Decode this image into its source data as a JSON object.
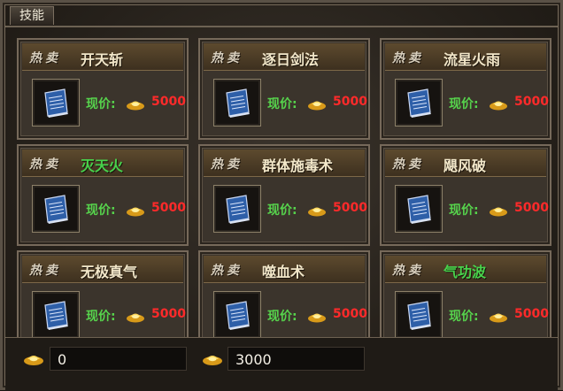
{
  "window": {
    "tab_title": "技能"
  },
  "shop": {
    "hot_label": "热卖",
    "price_label": "现价:",
    "items": [
      {
        "name": "开天斩",
        "price": "5000",
        "name_color": "#f2e7c9"
      },
      {
        "name": "逐日剑法",
        "price": "5000",
        "name_color": "#f2e7c9"
      },
      {
        "name": "流星火雨",
        "price": "5000",
        "name_color": "#f2e7c9"
      },
      {
        "name": "灭天火",
        "price": "5000",
        "name_color": "#48d24c"
      },
      {
        "name": "群体施毒术",
        "price": "5000",
        "name_color": "#f2e7c9"
      },
      {
        "name": "飓风破",
        "price": "5000",
        "name_color": "#f2e7c9"
      },
      {
        "name": "无极真气",
        "price": "5000",
        "name_color": "#f2e7c9"
      },
      {
        "name": "噬血术",
        "price": "5000",
        "name_color": "#f2e7c9"
      },
      {
        "name": "气功波",
        "price": "5000",
        "name_color": "#48d24c"
      }
    ]
  },
  "currency": {
    "left_value": "0",
    "right_value": "3000"
  },
  "icons": {
    "skill_book": "blue-book-icon",
    "gold": "gold-ingot-icon"
  },
  "colors": {
    "price": "#ff2a2a",
    "price_label": "#56d34c",
    "highlight_name": "#48d24c"
  }
}
